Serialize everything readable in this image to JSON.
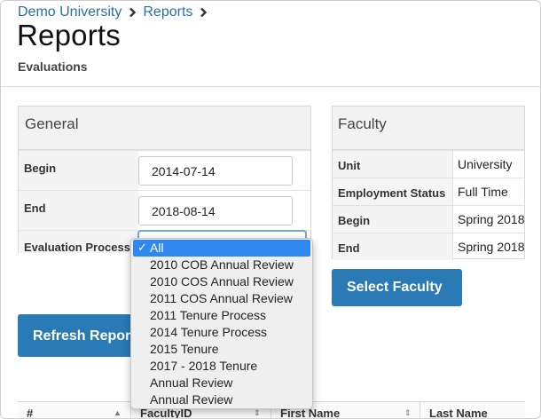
{
  "breadcrumb": {
    "items": [
      "Demo University",
      "Reports"
    ]
  },
  "header": {
    "title": "Reports",
    "subtitle": "Evaluations"
  },
  "general": {
    "title": "General",
    "begin_label": "Begin",
    "begin_value": "2014-07-14",
    "end_label": "End",
    "end_value": "2018-08-14",
    "process_label": "Evaluation Process"
  },
  "dropdown": {
    "check": "✓",
    "options": [
      "All",
      "2010 COB Annual Review",
      "2010 COS Annual Review",
      "2011 COS Annual Review",
      "2011 Tenure Process",
      "2014 Tenure Process",
      "2015 Tenure",
      "2017 - 2018 Tenure",
      "Annual Review",
      "Annual Review"
    ]
  },
  "faculty": {
    "title": "Faculty",
    "rows": [
      {
        "label": "Unit",
        "value": "University"
      },
      {
        "label": "Employment Status",
        "value": "Full Time"
      },
      {
        "label": "Begin",
        "value": "Spring 2018"
      },
      {
        "label": "End",
        "value": "Spring 2018"
      }
    ]
  },
  "buttons": {
    "select_faculty": "Select Faculty",
    "refresh": "Refresh Report"
  },
  "table": {
    "headers": [
      "#",
      "FacultyID",
      "First Name",
      "Last Name"
    ]
  },
  "colors": {
    "link": "#2a6fa8",
    "button": "#2a7ab5",
    "selected_option": "#2f87f0"
  }
}
